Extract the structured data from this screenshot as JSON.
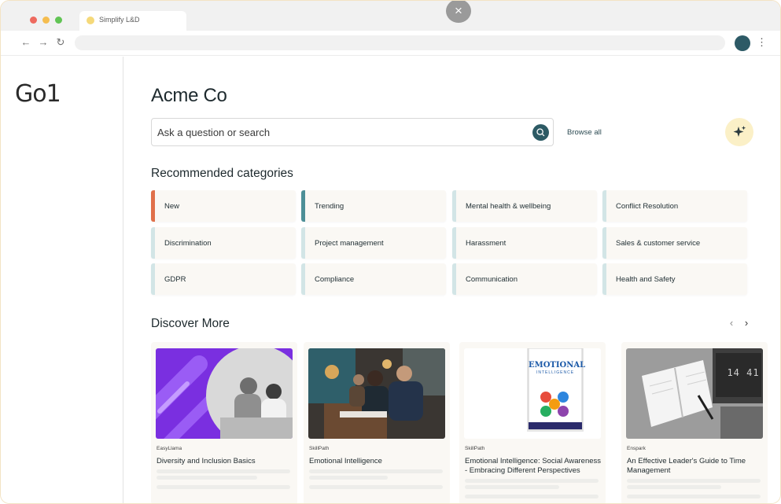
{
  "browser": {
    "tab_title": "Simplify L&D",
    "overlay_close_icon": "×",
    "nav": {
      "back": "←",
      "forward": "→",
      "reload": "↻",
      "menu": "⋮"
    },
    "colors": {
      "profile": "#2d5a66"
    }
  },
  "sidebar": {
    "logo": "Go1"
  },
  "main": {
    "org_title": "Acme Co",
    "search": {
      "placeholder": "Ask a question or search"
    },
    "browse_all": "Browse all",
    "ai_icon": "sparkles-icon",
    "recommended_title": "Recommended categories",
    "categories": [
      {
        "label": "New",
        "accent": "#e0704a"
      },
      {
        "label": "Trending",
        "accent": "#4d8f97"
      },
      {
        "label": "Mental health & wellbeing",
        "accent": "#d2e5e6"
      },
      {
        "label": "Conflict Resolution",
        "accent": "#d2e5e6"
      },
      {
        "label": "Discrimination",
        "accent": "#d2e5e6"
      },
      {
        "label": "Project management",
        "accent": "#d2e5e6"
      },
      {
        "label": "Harassment",
        "accent": "#d2e5e6"
      },
      {
        "label": "Sales & customer service",
        "accent": "#d2e5e6"
      },
      {
        "label": "GDPR",
        "accent": "#d2e5e6"
      },
      {
        "label": "Compliance",
        "accent": "#d2e5e6"
      },
      {
        "label": "Communication",
        "accent": "#d2e5e6"
      },
      {
        "label": "Health and Safety",
        "accent": "#d2e5e6"
      }
    ],
    "discover_title": "Discover More",
    "carousel": {
      "prev": "‹",
      "next": "›"
    },
    "cards": [
      {
        "provider": "EasyLlama",
        "title": "Diversity and Inclusion Basics"
      },
      {
        "provider": "SkillPath",
        "title": "Emotional Intelligence"
      },
      {
        "provider": "SkillPath",
        "title": "Emotional Intelligence: Social Awareness - Embracing Different Perspectives",
        "book_title": "EMOTIONAL",
        "book_subtitle": "INTELLIGENCE"
      },
      {
        "provider": "Enspark",
        "title": "An Effective Leader's Guide to Time Management",
        "clock": "14 41"
      }
    ]
  }
}
